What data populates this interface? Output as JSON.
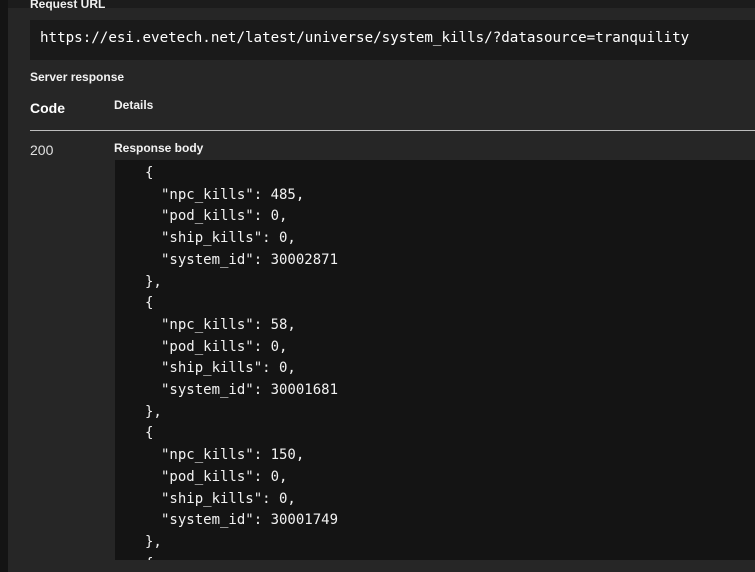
{
  "request": {
    "label": "Request URL",
    "url": "https://esi.evetech.net/latest/universe/system_kills/?datasource=tranquility"
  },
  "server_response": {
    "label": "Server response",
    "columns": {
      "code": "Code",
      "details": "Details"
    },
    "status_code": "200",
    "body_label": "Response body",
    "body_lines": [
      {
        "indent": 0,
        "text": "{"
      },
      {
        "indent": 1,
        "text": "\"npc_kills\": 485,"
      },
      {
        "indent": 1,
        "text": "\"pod_kills\": 0,"
      },
      {
        "indent": 1,
        "text": "\"ship_kills\": 0,"
      },
      {
        "indent": 1,
        "text": "\"system_id\": 30002871"
      },
      {
        "indent": 0,
        "text": "},"
      },
      {
        "indent": 0,
        "text": "{"
      },
      {
        "indent": 1,
        "text": "\"npc_kills\": 58,"
      },
      {
        "indent": 1,
        "text": "\"pod_kills\": 0,"
      },
      {
        "indent": 1,
        "text": "\"ship_kills\": 0,"
      },
      {
        "indent": 1,
        "text": "\"system_id\": 30001681"
      },
      {
        "indent": 0,
        "text": "},"
      },
      {
        "indent": 0,
        "text": "{"
      },
      {
        "indent": 1,
        "text": "\"npc_kills\": 150,"
      },
      {
        "indent": 1,
        "text": "\"pod_kills\": 0,"
      },
      {
        "indent": 1,
        "text": "\"ship_kills\": 0,"
      },
      {
        "indent": 1,
        "text": "\"system_id\": 30001749"
      },
      {
        "indent": 0,
        "text": "},"
      },
      {
        "indent": 0,
        "text": "{"
      }
    ]
  }
}
